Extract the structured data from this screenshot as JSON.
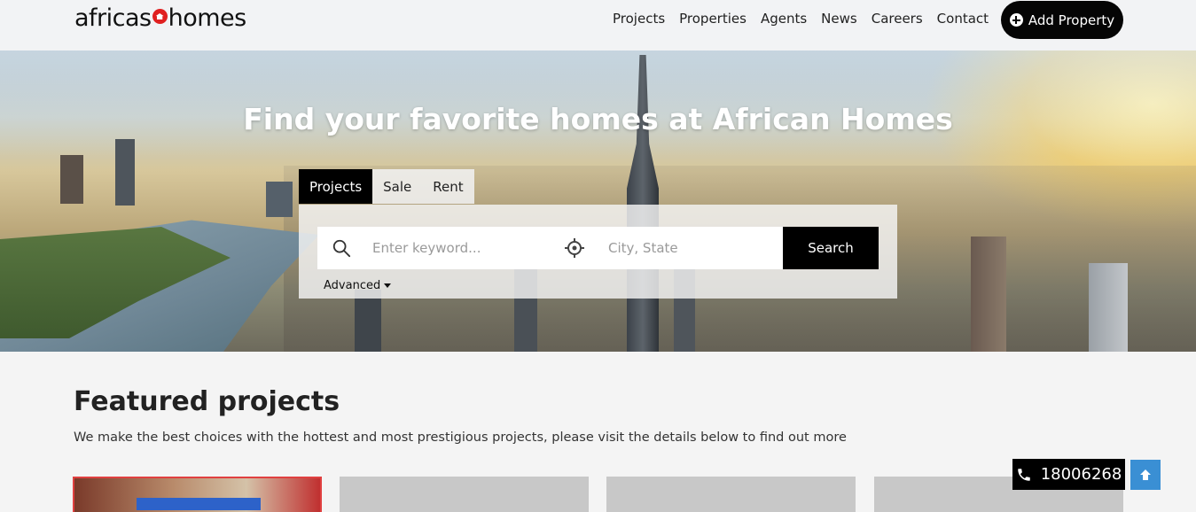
{
  "header": {
    "logo_left": "africas",
    "logo_right": "homes",
    "nav": [
      "Projects",
      "Properties",
      "Agents",
      "News",
      "Careers",
      "Contact"
    ],
    "add_property_label": "Add Property",
    "add_property_icon": "plus-circle-icon"
  },
  "hero": {
    "title": "Find your favorite homes at African Homes",
    "tabs": [
      {
        "label": "Projects",
        "active": true
      },
      {
        "label": "Sale",
        "active": false
      },
      {
        "label": "Rent",
        "active": false
      }
    ],
    "search": {
      "keyword_placeholder": "Enter keyword...",
      "keyword_value": "",
      "location_placeholder": "City, State",
      "location_value": "",
      "button_label": "Search",
      "advanced_label": "Advanced"
    }
  },
  "featured": {
    "title": "Featured projects",
    "subtitle": "We make the best choices with the hottest and most prestigious projects, please visit the details below to find out more"
  },
  "floating": {
    "phone": "18006268",
    "phone_icon": "phone-icon",
    "scroll_top_icon": "arrow-up-icon"
  },
  "colors": {
    "brand_red": "#e02020",
    "primary_black": "#000000",
    "scroll_top_blue": "#3a8fd4"
  }
}
